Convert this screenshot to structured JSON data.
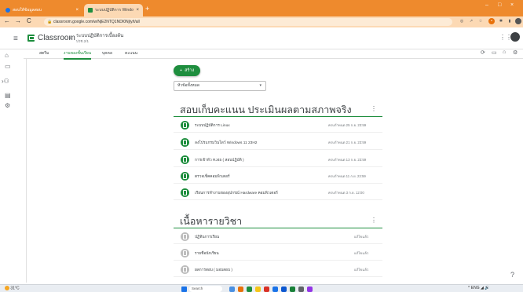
{
  "browser": {
    "tabs": [
      {
        "label": "สอบให้ข้อมูลสอบ",
        "close": "×"
      },
      {
        "label": "ระบบปฏิบัติการ Windows",
        "close": "×"
      }
    ],
    "new_tab": "+",
    "window_controls": {
      "minimize": "–",
      "maximize": "□",
      "close": "×"
    },
    "url": "classroom.google.com/w/NjE2NTQ1NDI0NjIy/t/all",
    "nav": {
      "back": "←",
      "forward": "→",
      "reload": "C"
    }
  },
  "header": {
    "menu_icon": "≡",
    "app_title": "Classroom",
    "chevron": "›",
    "class_name": "ระบบปฏิบัติการเบื้องต้น",
    "class_section": "ปวช.2/1",
    "apps_icon": "⋮⋮"
  },
  "class_tabs": {
    "items": [
      {
        "label": "สตรีม"
      },
      {
        "label": "งานของชั้นเรียน"
      },
      {
        "label": "บุคคล"
      },
      {
        "label": "คะแนน"
      }
    ]
  },
  "toolbar_icons": [
    "meet-icon",
    "calendar-icon",
    "drive-icon",
    "settings-icon"
  ],
  "main": {
    "create_label": "สร้าง",
    "create_plus": "+",
    "filter": {
      "value": "หัวข้อทั้งหมด",
      "arrow": "▾"
    },
    "topics": [
      {
        "title": "สอบเก็บคะแนน ประเมินผลตามสภาพจริง",
        "menu": "⋮",
        "items": [
          {
            "name": "ระบบปฏิบัติการ Linux",
            "date": "ครบกำหนด 25 ก.ย. 23:59"
          },
          {
            "name": "ลงโปรแกรมวินโดว์ Windows 11 23H2",
            "date": "ครบกำหนด 21 ก.ย. 23:59"
          },
          {
            "name": "การเข้าหัว RJ45 ( สอบปฏิบัติ )",
            "date": "ครบกำหนด 13 ก.ย. 23:59"
          },
          {
            "name": "ตรวจเช็คคอมพิวเตอร์",
            "date": "ครบกำหนด 11 ก.ย. 23:59"
          },
          {
            "name": "เรียนการทำงานของอุปกรณ์ Hardware คอมพิวเตอร์",
            "date": "ครบกำหนด 3 ก.ย. 12:00"
          }
        ]
      },
      {
        "title": "เนื้อหารายวิชา",
        "menu": "⋮",
        "items": [
          {
            "name": "ปฏิทินการเรียน",
            "date": "แก้ไขแล้ว"
          },
          {
            "name": "รายชื่อนักเรียน",
            "date": "แก้ไขแล้ว"
          },
          {
            "name": "ผลการสอบ ( มอบสอบ )",
            "date": "แก้ไขแล้ว"
          }
        ]
      }
    ]
  },
  "help_icon": "?",
  "taskbar": {
    "weather": "31°C",
    "search_placeholder": "Search",
    "tray": "ENG"
  },
  "colors": {
    "accent": "#1e8e3e",
    "tabstrip": "#ee8a2d",
    "addressbar": "#fcd9b4"
  }
}
